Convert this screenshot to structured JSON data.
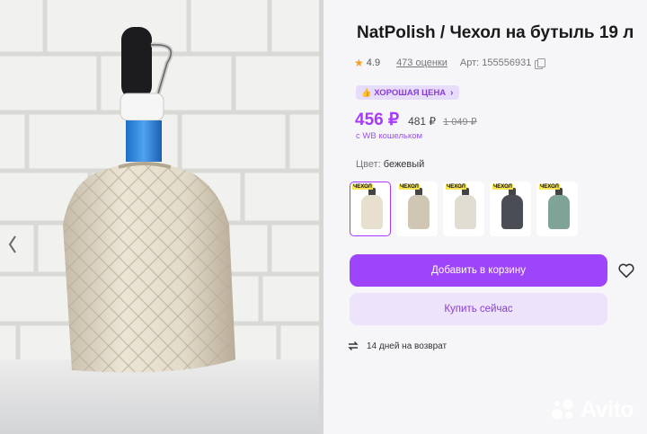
{
  "product": {
    "title": "NatPolish / Чехол на бутыль 19 л",
    "rating": "4.9",
    "reviews": "473 оценки",
    "article": "Арт: 155556931",
    "badge": "ХОРОШАЯ ЦЕНА",
    "price": "456 ₽",
    "price_no_wallet": "481 ₽",
    "price_old": "1 049 ₽",
    "wallet_note": "с WB кошельком",
    "color_label": "Цвет:",
    "color_value": "бежевый",
    "variants": [
      {
        "label": "ЧЕХОЛ",
        "color": "#e8e0cf",
        "selected": true
      },
      {
        "label": "ЧЕХОЛ",
        "color": "#cfc6b4",
        "selected": false
      },
      {
        "label": "ЧЕХОЛ",
        "color": "#e2ddd2",
        "selected": false
      },
      {
        "label": "ЧЕХОЛ",
        "color": "#4a4d55",
        "selected": false
      },
      {
        "label": "ЧЕХОЛ",
        "color": "#7fa396",
        "selected": false
      }
    ],
    "add_to_cart": "Добавить в корзину",
    "buy_now": "Купить сейчас",
    "returns": "14 дней на возврат"
  },
  "watermark": "Avito",
  "colors": {
    "accent": "#a73afd",
    "button": "#9e45fb",
    "button_secondary": "#ede3fb",
    "star": "#f2a023"
  },
  "icons": [
    "chevron-left-icon",
    "star-icon",
    "copy-icon",
    "thumbs-up-icon",
    "chevron-right-icon",
    "heart-icon",
    "return-arrows-icon",
    "avito-logo-icon"
  ]
}
